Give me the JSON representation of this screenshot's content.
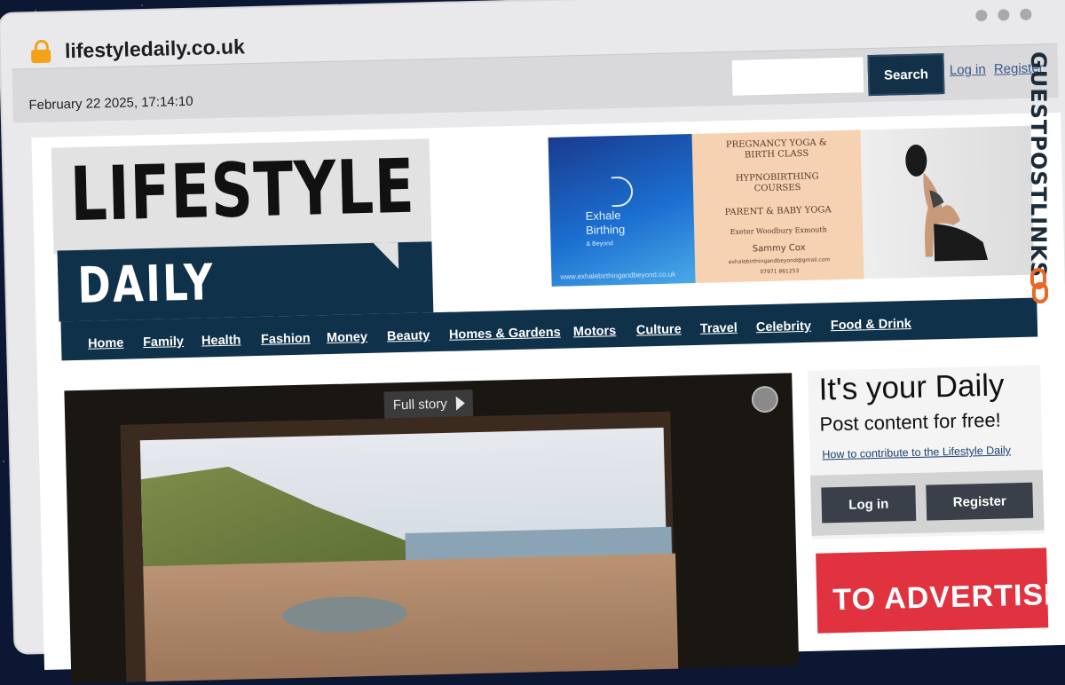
{
  "browser": {
    "url": "lifestyledaily.co.uk"
  },
  "topbar": {
    "date": "February 22 2025, 17:14:10",
    "search_label": "Search",
    "login_label": "Log in",
    "register_label": "Register"
  },
  "logo": {
    "line1": "LIFESTYLE",
    "line2": "DAILY"
  },
  "ad": {
    "brand_line1": "Exhale",
    "brand_line2": "Birthing",
    "brand_line3": "& Beyond",
    "site": "www.exhalebirthingandbeyond.co.uk",
    "lines": [
      "PREGNANCY YOGA &",
      "BIRTH CLASS",
      "HYPNOBIRTHING",
      "COURSES",
      "PARENT & BABY YOGA",
      "Exeter   Woodbury   Exmouth",
      "Sammy Cox",
      "exhalebirthingandbeyond@gmail.com",
      "07971 861253"
    ]
  },
  "nav": {
    "items": [
      "Home",
      "Family",
      "Health",
      "Fashion",
      "Money",
      "Beauty",
      "Homes & Gardens",
      "Motors",
      "Culture",
      "Travel",
      "Celebrity",
      "Food & Drink"
    ]
  },
  "hero": {
    "full_story": "Full story"
  },
  "sidebar": {
    "headline": "It's your Daily",
    "subline": "Post content for free!",
    "how_link": "How to contribute to the Lifestyle Daily",
    "login_label": "Log in",
    "register_label": "Register",
    "advertise": "TO ADVERTISE"
  },
  "watermark": {
    "text": "GUESTPOSTLINKS"
  },
  "colors": {
    "navy": "#0f3149",
    "accent_red": "#e0323f",
    "lock": "#f3a21a"
  }
}
